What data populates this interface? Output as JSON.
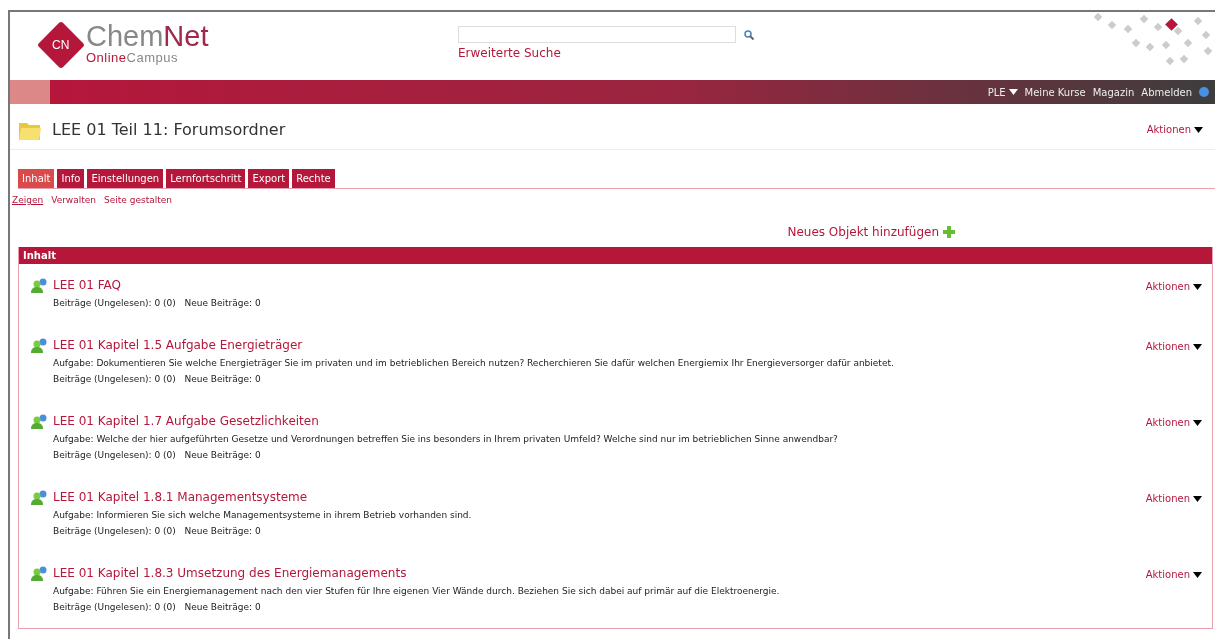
{
  "logo": {
    "mark": "CN",
    "name_1": "Chem",
    "name_2": "Net",
    "tagline_1": "Online",
    "tagline_2": "Campus"
  },
  "search": {
    "link": "Erweiterte Suche"
  },
  "top_nav": [
    {
      "label": "PLE",
      "dropdown": true
    },
    {
      "label": "Meine Kurse",
      "dropdown": false
    },
    {
      "label": "Magazin",
      "dropdown": false
    },
    {
      "label": "Abmelden",
      "dropdown": false
    }
  ],
  "page_title": "LEE 01 Teil 11: Forumsordner",
  "title_actions": "Aktionen",
  "tabs": [
    {
      "label": "Inhalt",
      "selected": true
    },
    {
      "label": "Info",
      "selected": false
    },
    {
      "label": "Einstellungen",
      "selected": false
    },
    {
      "label": "Lernfortschritt",
      "selected": false
    },
    {
      "label": "Export",
      "selected": false
    },
    {
      "label": "Rechte",
      "selected": false
    }
  ],
  "subtabs": [
    {
      "label": "Zeigen",
      "selected": true
    },
    {
      "label": "Verwalten",
      "selected": false
    },
    {
      "label": "Seite gestalten",
      "selected": false
    }
  ],
  "add_object": "Neues Objekt hinzufügen",
  "panel_title": "Inhalt",
  "items": [
    {
      "title": "LEE 01 FAQ",
      "stats": "Beiträge (Ungelesen): 0 (0)   Neue Beiträge: 0",
      "actions": "Aktionen"
    },
    {
      "title": "LEE 01 Kapitel 1.5 Aufgabe Energieträger",
      "description": "Aufgabe: Dokumentieren Sie welche Energieträger Sie im privaten und im betrieblichen Bereich nutzen? Recherchieren Sie dafür welchen Energiemix Ihr Energieversorger dafür anbietet.",
      "stats": "Beiträge (Ungelesen): 0 (0)   Neue Beiträge: 0",
      "actions": "Aktionen"
    },
    {
      "title": "LEE 01 Kapitel 1.7 Aufgabe Gesetzlichkeiten",
      "description": "Aufgabe: Welche der hier aufgeführten Gesetze und Verordnungen betreffen Sie ins besonders in Ihrem privaten Umfeld? Welche sind nur im betrieblichen Sinne anwendbar?",
      "stats": "Beiträge (Ungelesen): 0 (0)   Neue Beiträge: 0",
      "actions": "Aktionen"
    },
    {
      "title": "LEE 01 Kapitel 1.8.1 Managementsysteme",
      "description": "Aufgabe: Informieren Sie sich welche Managementsysteme in ihrem Betrieb vorhanden sind.",
      "stats": "Beiträge (Ungelesen): 0 (0)   Neue Beiträge: 0",
      "actions": "Aktionen"
    },
    {
      "title": "LEE 01 Kapitel 1.8.3 Umsetzung des Energiemanagements",
      "description": "Aufgabe: Führen Sie ein Energiemanagement nach den vier Stufen für Ihre eigenen Vier Wände durch. Beziehen Sie sich dabei auf primär auf die Elektroenergie.",
      "stats": "Beiträge (Ungelesen): 0 (0)   Neue Beiträge: 0",
      "actions": "Aktionen"
    }
  ]
}
